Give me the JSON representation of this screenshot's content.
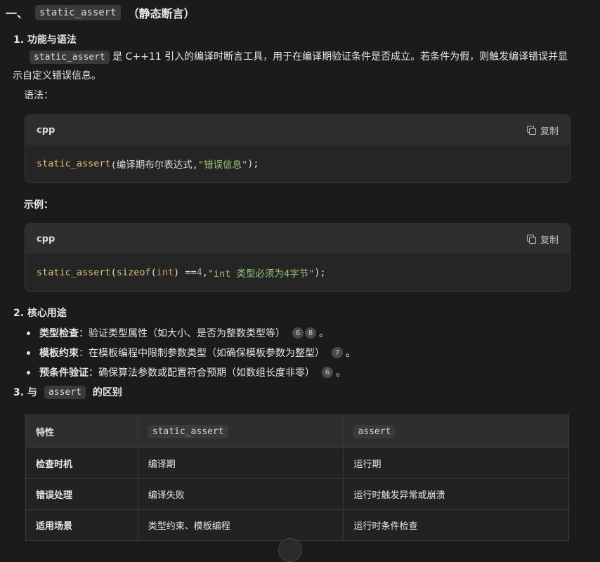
{
  "heading": {
    "prefix": "一、",
    "code": "static_assert",
    "suffix": "（静态断言）"
  },
  "section1": {
    "title": "1. 功能与语法",
    "desc_code": "static_assert",
    "desc_text": " 是 C++11 引入的编译时断言工具，用于在编译期验证条件是否成立。若条件为假，则触发编译错误并显示自定义错误信息。",
    "syntax_label": "语法：",
    "example_label": "示例：",
    "code1": {
      "lang": "cpp",
      "copy": "复制",
      "fn": "static_assert",
      "open": "(编译期布尔表达式, ",
      "str": "\"错误信息\"",
      "close": ");"
    },
    "code2": {
      "lang": "cpp",
      "copy": "复制",
      "fn": "static_assert",
      "p1": "(",
      "fn2": "sizeof",
      "p2": "(",
      "kw": "int",
      "p3": ") == ",
      "num": "4",
      "p4": ", ",
      "str": "\"int 类型必须为4字节\"",
      "close": ");"
    }
  },
  "section2": {
    "title": "2. 核心用途",
    "items": [
      {
        "bold": "类型检查",
        "text": "：验证类型属性（如大小、是否为整数类型等）",
        "cites": [
          "6",
          "8"
        ],
        "end": "。"
      },
      {
        "bold": "模板约束",
        "text": "：在模板编程中限制参数类型（如确保模板参数为整型）",
        "cites": [
          "7"
        ],
        "end": "。"
      },
      {
        "bold": "预条件验证",
        "text": "：确保算法参数或配置符合预期（如数组长度非零）",
        "cites": [
          "6"
        ],
        "end": "。"
      }
    ]
  },
  "section3": {
    "title_pre": "3. 与",
    "title_code": "assert",
    "title_post": "的区别",
    "table": {
      "headers": [
        "特性",
        "static_assert",
        "assert"
      ],
      "rows": [
        [
          "检查时机",
          "编译期",
          "运行期"
        ],
        [
          "错误处理",
          "编译失败",
          "运行时触发异常或崩溃"
        ],
        [
          "适用场景",
          "类型约束、模板编程",
          "运行时条件检查"
        ]
      ]
    }
  }
}
